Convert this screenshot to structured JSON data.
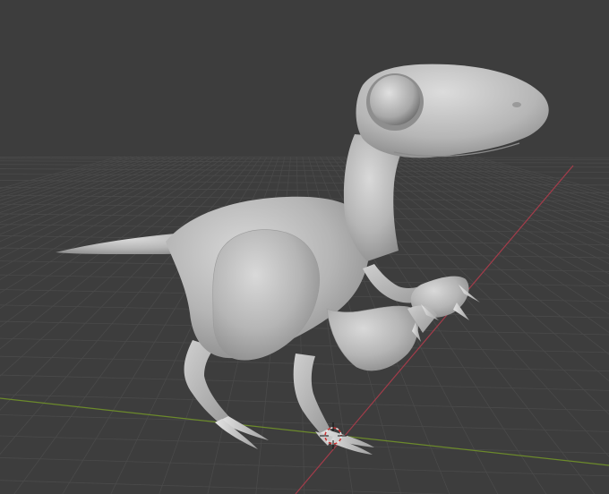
{
  "app": {
    "kind": "3d-viewport",
    "view_mode": "solid-shading"
  },
  "scene": {
    "object_name": "",
    "object_kind": "dinosaur-sculpt-mesh",
    "has_3d_cursor": true
  },
  "colors": {
    "background": "#3d3d3d",
    "grid_line": "#4a4a4a",
    "x_axis": "#a33c4a",
    "y_axis": "#6c8a2b",
    "mesh_base": "#b3b3b3",
    "mesh_highlight": "#d6d6d6",
    "mesh_shadow": "#8a8a8a"
  }
}
